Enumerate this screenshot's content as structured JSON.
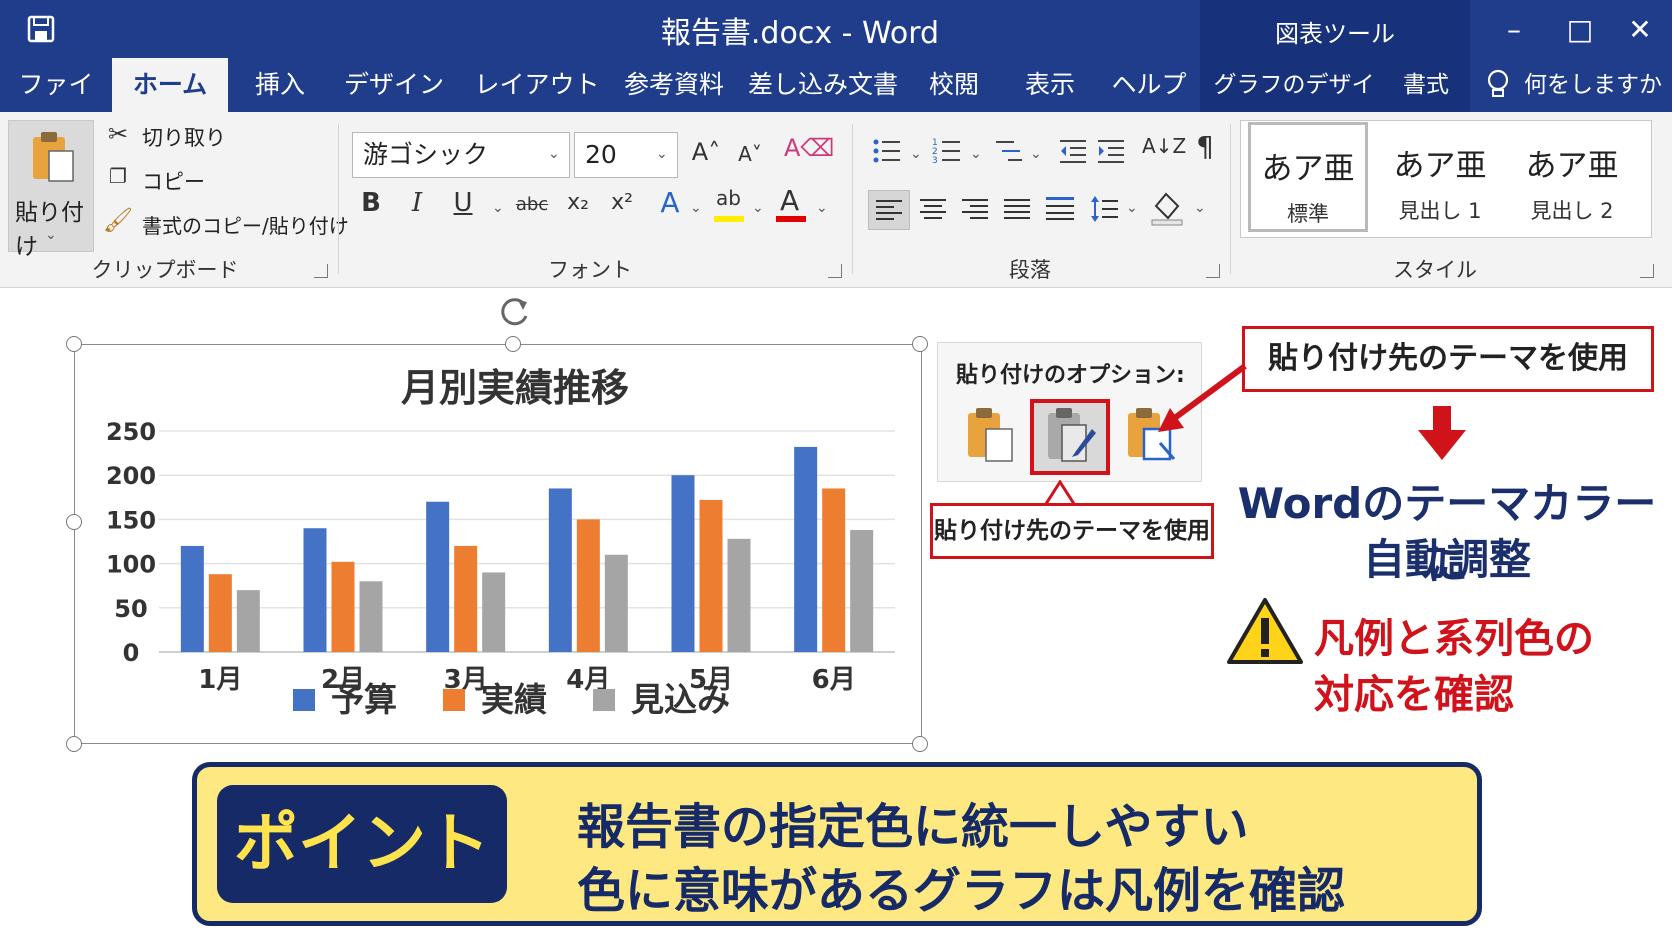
{
  "window": {
    "title": "報告書.docx  -  Word",
    "context_tool": "図表ツール"
  },
  "tabs": {
    "file": "ファイル",
    "home": "ホーム",
    "insert": "挿入",
    "design": "デザイン",
    "layout": "レイアウト",
    "references": "参考資料",
    "mailings": "差し込み文書",
    "review": "校閲",
    "view": "表示",
    "help": "ヘルプ",
    "chart_design": "グラフのデザイン",
    "format": "書式",
    "tell_me": "何をしますか"
  },
  "ribbon": {
    "clipboard": {
      "paste_label": "貼り付け",
      "cut_label": "切り取り",
      "copy_label": "コピー",
      "format_painter_label": "書式のコピー/貼り付け",
      "group_label": "クリップボード"
    },
    "font": {
      "font_name": "游ゴシック",
      "font_size": "20",
      "group_label": "フォント",
      "bold": "B",
      "italic": "I",
      "underline": "U",
      "strike": "abc",
      "sub": "x₂",
      "sup": "x²"
    },
    "paragraph": {
      "group_label": "段落",
      "pilcrow": "¶"
    },
    "styles": {
      "group_label": "スタイル",
      "sample": "あア亜",
      "items": [
        {
          "label": "標準"
        },
        {
          "label": "見出し 1"
        },
        {
          "label": "見出し 2"
        }
      ]
    }
  },
  "chart_data": {
    "type": "bar",
    "title": "月別実績推移",
    "categories": [
      "1月",
      "2月",
      "3月",
      "4月",
      "5月",
      "6月"
    ],
    "series": [
      {
        "name": "予算",
        "color": "#4472c4",
        "values": [
          120,
          140,
          170,
          185,
          200,
          232
        ]
      },
      {
        "name": "実績",
        "color": "#ed7d31",
        "values": [
          88,
          102,
          120,
          150,
          172,
          185
        ]
      },
      {
        "name": "見込み",
        "color": "#a5a5a5",
        "values": [
          70,
          80,
          90,
          110,
          128,
          138
        ]
      }
    ],
    "ylim": [
      0,
      250
    ],
    "yticks": [
      0,
      50,
      100,
      150,
      200,
      250
    ],
    "grid": true,
    "legend": "bottom"
  },
  "paste_options": {
    "title": "貼り付けのオプション:",
    "tooltip": "貼り付け先のテーマを使用"
  },
  "annotations": {
    "callout": "貼り付け先のテーマを使用",
    "result_line1": "Wordのテーマカラーに",
    "result_line2": "自動調整",
    "warning_line1": "凡例と系列色の",
    "warning_line2": "対応を確認"
  },
  "point": {
    "tag": "ポイント",
    "line1": "報告書の指定色に統一しやすい",
    "line2": "色に意味があるグラフは凡例を確認"
  }
}
